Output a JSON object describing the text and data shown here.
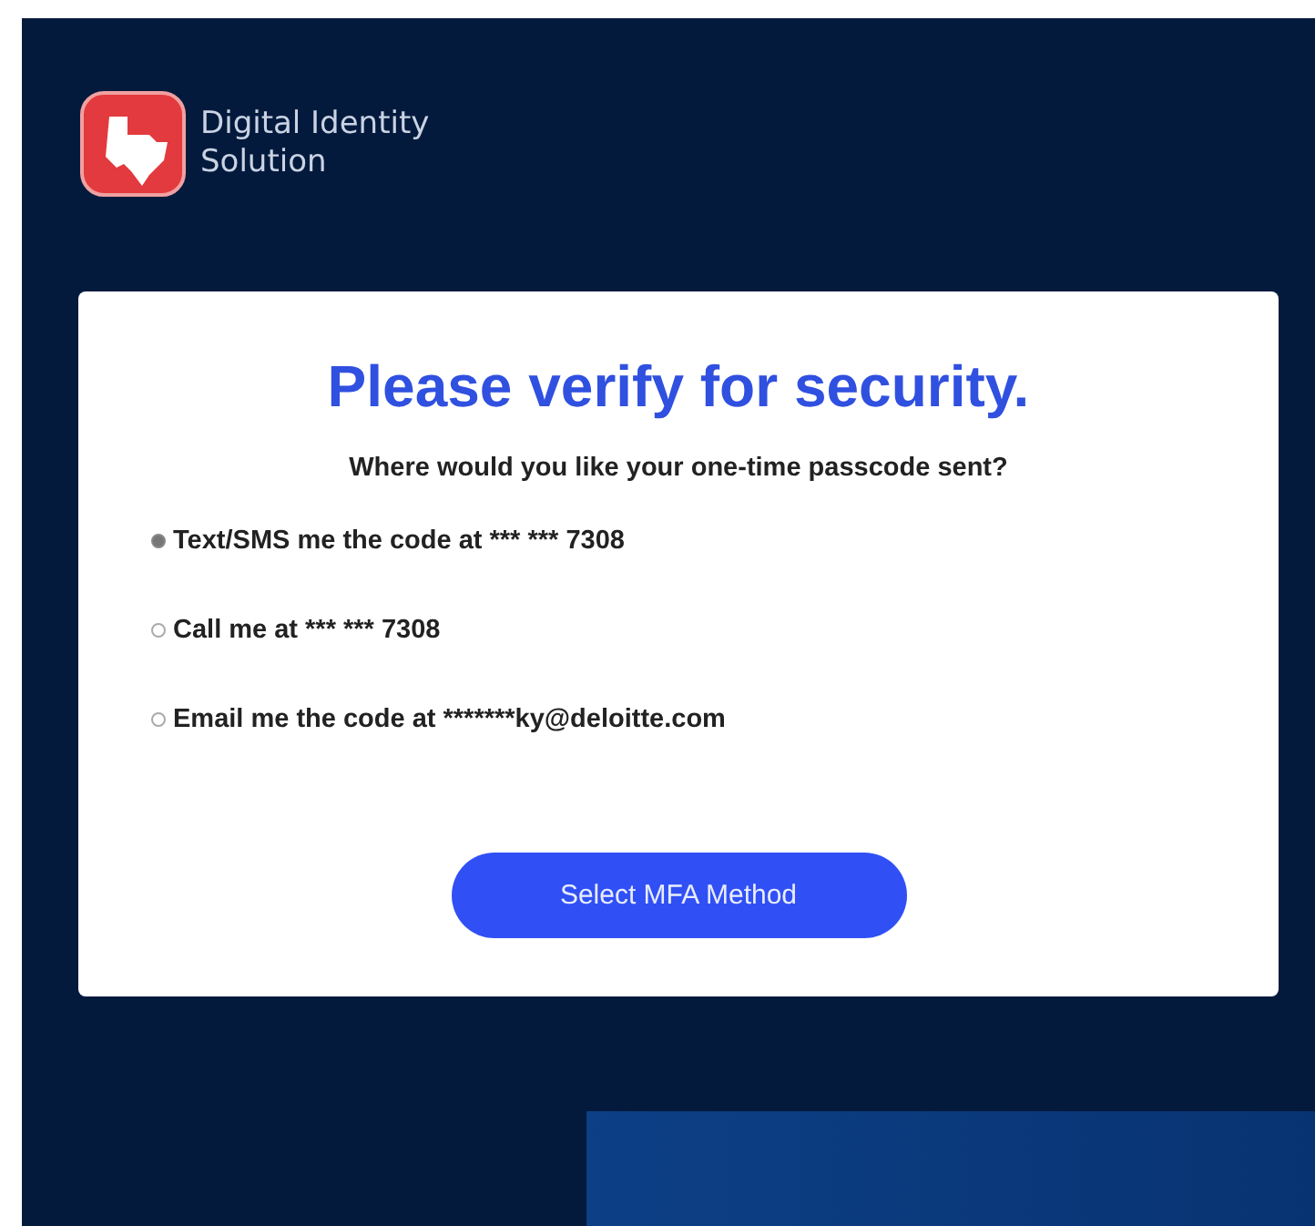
{
  "brand": {
    "name": "Digital Identity Solution"
  },
  "card": {
    "title": "Please verify for security.",
    "question": "Where would you like your one-time passcode sent?",
    "options": [
      {
        "label": "Text/SMS me the code at *** *** 7308",
        "selected": true
      },
      {
        "label": "Call me at *** *** 7308",
        "selected": false
      },
      {
        "label": "Email me the code at *******ky@deloitte.com",
        "selected": false
      }
    ],
    "button": "Select MFA Method"
  }
}
